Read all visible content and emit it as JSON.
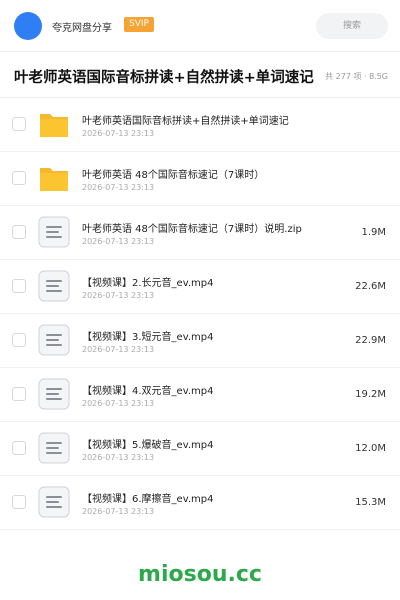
{
  "header": {
    "share_title": "夸克网盘分享",
    "badge": "SVIP",
    "search_placeholder": "搜索"
  },
  "page": {
    "title": "叶老师英语国际音标拼读+自然拼读+单词速记",
    "file_count": "共 277 项 · 8.5G"
  },
  "files": [
    {
      "name": "叶老师英语国际音标拼读+自然拼读+单词速记",
      "date": "2026-07-13 23:13",
      "size": "",
      "icon": "folder-icon"
    },
    {
      "name": "叶老师英语 48个国际音标速记（7课时）",
      "date": "2026-07-13 23:13",
      "size": "",
      "icon": "folder-icon"
    },
    {
      "name": "叶老师英语 48个国际音标速记（7课时）说明.zip",
      "date": "2026-07-13 23:13",
      "size": "1.9M",
      "icon": "file-icon"
    },
    {
      "name": "【视频课】2.长元音_ev.mp4",
      "date": "2026-07-13 23:13",
      "size": "22.6M",
      "icon": "file-icon"
    },
    {
      "name": "【视频课】3.短元音_ev.mp4",
      "date": "2026-07-13 23:13",
      "size": "22.9M",
      "icon": "file-icon"
    },
    {
      "name": "【视频课】4.双元音_ev.mp4",
      "date": "2026-07-13 23:13",
      "size": "19.2M",
      "icon": "file-icon"
    },
    {
      "name": "【视频课】5.爆破音_ev.mp4",
      "date": "2026-07-13 23:13",
      "size": "12.0M",
      "icon": "file-icon"
    },
    {
      "name": "【视频课】6.摩擦音_ev.mp4",
      "date": "2026-07-13 23:13",
      "size": "15.3M",
      "icon": "file-icon"
    }
  ],
  "watermark": "miosou.cc",
  "colors": {
    "accent": "#2f7ef5",
    "svip": "#f7a334",
    "folder": "#fbc531",
    "watermark": "#2ea84d"
  }
}
